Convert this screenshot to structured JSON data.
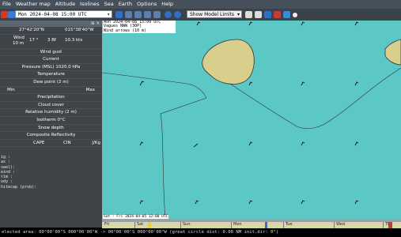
{
  "menu": [
    "File",
    "Weather map",
    "Altitude",
    "Isolines",
    "Sea",
    "Earth",
    "Options",
    "Help"
  ],
  "toolbar": {
    "date": "Mon 2024-04-08 15:00 UTC",
    "model_limits": "Show Model Limits"
  },
  "panel": {
    "lat": "27°42'20\"N",
    "lon": "015°38'40\"W",
    "wind_label": "Wind",
    "wind_height": "10 m",
    "wind_dir": "17 °",
    "wind_bf": "3 Bf",
    "wind_kts": "10.3 kts",
    "rows": [
      "Wind gust",
      "Current",
      "Pressure (MSL) 1020.0 hPa",
      "Temperature",
      "Dew point (2 m)"
    ],
    "min_label": "Min",
    "max_label": "Max",
    "rows2": [
      "Precipitation",
      "Cloud cover",
      "Relative humidity (2 m)",
      "Isotherm 0°C",
      "Snow depth",
      "Composite Reflectivity"
    ],
    "cape": "CAPE",
    "cin": "CIN",
    "jkg": "J/Kg",
    "bottom_lines": [
      "ig  :",
      "ax  :",
      "swel):",
      "eind :",
      "rim :",
      "ody  :",
      "hitecap (prob):"
    ]
  },
  "map": {
    "info_lines": [
      "Mon 2024-04-08 15:00 UTC",
      "Vagues NWW (30P)",
      "Wind arrows (10 m)"
    ],
    "bottom_label": "Sat : Fri 2024-04-05 12:00 UTC"
  },
  "timeline": {
    "days": [
      "Fri",
      "Sat",
      "Sun",
      "Mon",
      "Tue",
      "Wed",
      "Thu"
    ]
  },
  "status": {
    "text": "elected area:  00°00'00\"S  000°00'00\"W -> 00°00'00\"S  000°00'00\"W   (great circle dist: 0.00 NM  init.dir: 0°)"
  }
}
